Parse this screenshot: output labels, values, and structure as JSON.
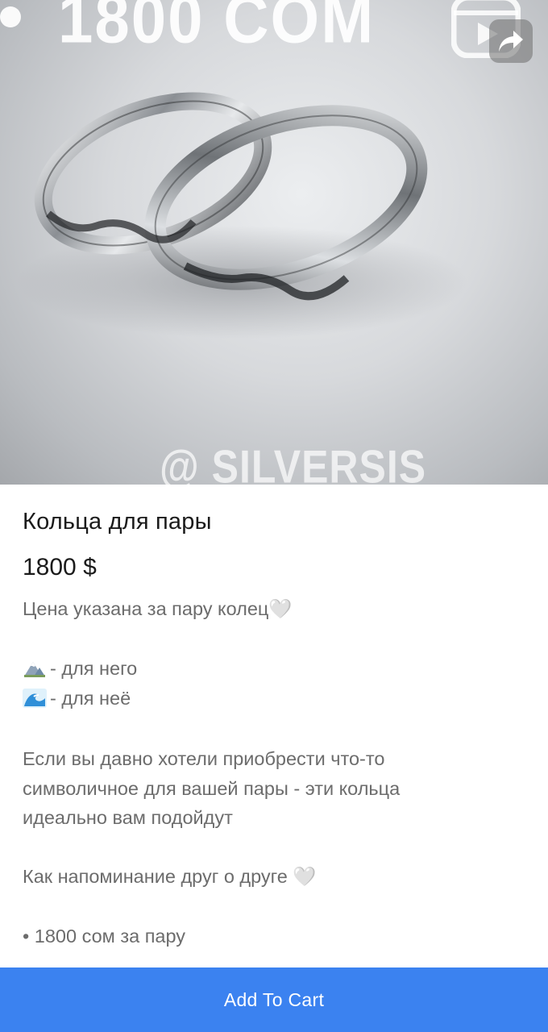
{
  "hero": {
    "overlay_text": "1800 COM",
    "watermark": "@  SILVERSIS",
    "icons": [
      "reels-icon",
      "share-icon"
    ]
  },
  "product": {
    "title": "Кольца для пары",
    "price": "1800 $",
    "price_note": "Цена указана за пару колец🤍",
    "his_label": "- для него",
    "hers_label": "- для неё",
    "description_lines": [
      "Если вы давно хотели приобрести что-то",
      "символичное для вашей пары - эти кольца",
      "идеально вам подойдут"
    ],
    "reminder": "Как напоминание друг о друге 🤍",
    "bullet": "• 1800 сом за пару"
  },
  "cart": {
    "button_label": "Add To Cart"
  },
  "colors": {
    "accent": "#3b82f0",
    "title_text": "#1b1b1b",
    "body_text": "#6c6c6c"
  }
}
